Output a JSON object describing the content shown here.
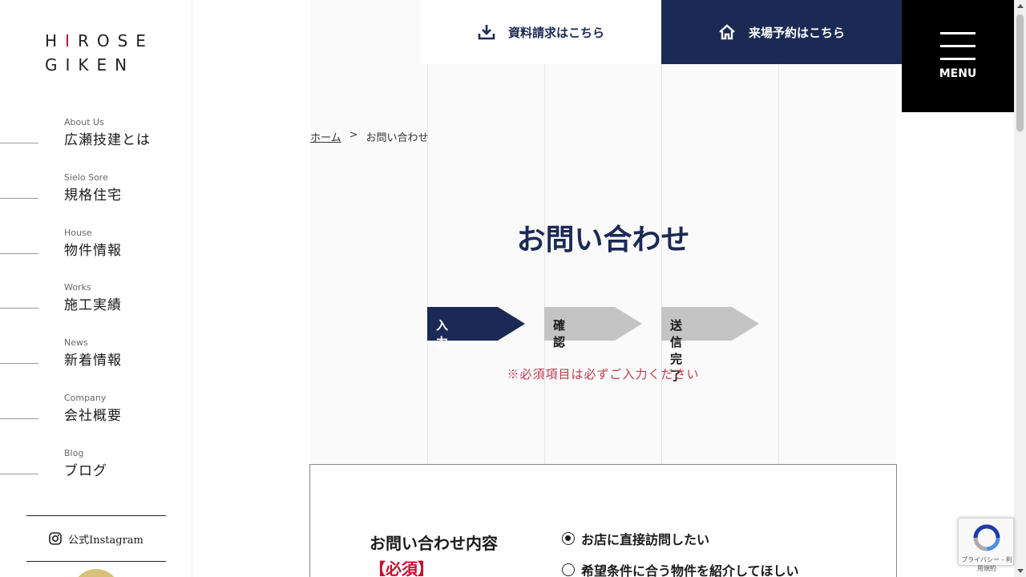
{
  "logo": {
    "line1_h": "H",
    "line1_i": "I",
    "line1_rest": "ROSE",
    "line2": "GIKEN"
  },
  "header": {
    "doc_request": "資料請求はこちら",
    "visit_reserve": "来場予約はこちら",
    "menu": "MENU"
  },
  "sidebar": {
    "items": [
      {
        "en": "About Us",
        "jp": "広瀬技建とは"
      },
      {
        "en": "Sielo Sore",
        "jp": "規格住宅"
      },
      {
        "en": "House",
        "jp": "物件情報"
      },
      {
        "en": "Works",
        "jp": "施工実績"
      },
      {
        "en": "News",
        "jp": "新着情報"
      },
      {
        "en": "Company",
        "jp": "会社概要"
      },
      {
        "en": "Blog",
        "jp": "ブログ"
      }
    ],
    "instagram": "公式Instagram"
  },
  "breadcrumb": {
    "home": "ホーム",
    "sep": ">",
    "current": "お問い合わせ"
  },
  "title": "お問い合わせ",
  "steps": [
    {
      "label": "入力",
      "color": "#1b2a55",
      "text_color": "#ffffff",
      "active": true
    },
    {
      "label": "確認",
      "color": "#c4c4c4",
      "text_color": "#1a1a1a",
      "active": false
    },
    {
      "label": "送信完了",
      "color": "#c4c4c4",
      "text_color": "#1a1a1a",
      "active": false
    }
  ],
  "notice": "※必須項目は必ずご入力ください",
  "form": {
    "field_label": "お問い合わせ内容",
    "required": "【必須】",
    "options": [
      {
        "label": "お店に直接訪問したい",
        "selected": true
      },
      {
        "label": "希望条件に合う物件を紹介してほしい",
        "selected": false
      }
    ]
  },
  "recaptcha": {
    "privacy": "プライバシー",
    "terms": "利用規約",
    "sep": " - "
  },
  "colors": {
    "navy": "#1b2a55",
    "red": "#c8102e",
    "notice": "#c0394b"
  }
}
